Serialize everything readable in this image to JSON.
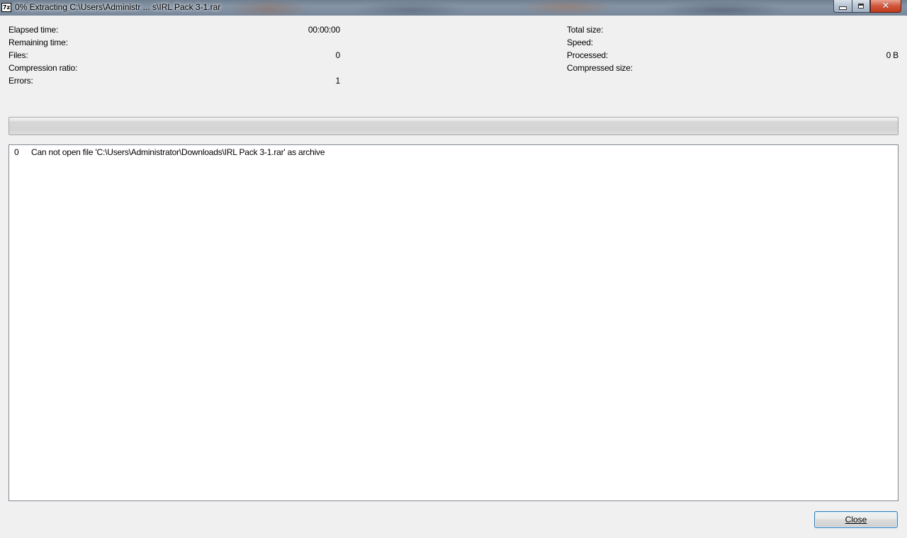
{
  "window": {
    "title": "0% Extracting C:\\Users\\Administr ... s\\IRL Pack 3-1.rar",
    "app_icon_text": "7z",
    "close_glyph": "✕"
  },
  "stats_left": [
    {
      "label": "Elapsed time:",
      "value": "00:00:00"
    },
    {
      "label": "Remaining time:",
      "value": ""
    },
    {
      "label": "Files:",
      "value": "0"
    },
    {
      "label": "Compression ratio:",
      "value": ""
    },
    {
      "label": "Errors:",
      "value": "1"
    }
  ],
  "stats_right": [
    {
      "label": "Total size:",
      "value": ""
    },
    {
      "label": "Speed:",
      "value": ""
    },
    {
      "label": "Processed:",
      "value": "0 B"
    },
    {
      "label": "Compressed size:",
      "value": ""
    }
  ],
  "progress": {
    "percent": 0,
    "fill_color": "#06b025"
  },
  "log": [
    {
      "num": "0",
      "message": "Can not open file 'C:\\Users\\Administrator\\Downloads\\IRL Pack 3-1.rar' as archive"
    }
  ],
  "buttons": {
    "close_label": "Close"
  },
  "icons": {
    "minimize": "minimize-icon",
    "maximize": "maximize-icon",
    "close": "close-icon",
    "app": "7zip-icon"
  }
}
